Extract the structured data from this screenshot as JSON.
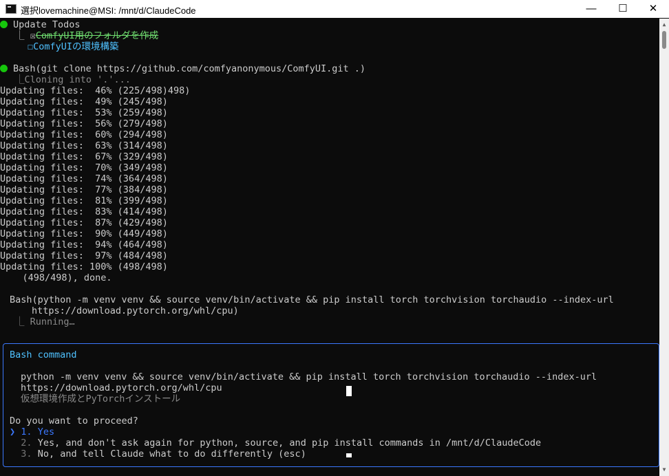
{
  "window": {
    "title": "選択lovemachine@MSI: /mnt/d/ClaudeCode",
    "minimize": "—",
    "maximize": "☐",
    "close": "✕"
  },
  "todos": {
    "header": "Update Todos",
    "items": [
      {
        "prefix": "⎿ ☒",
        "label": "ComfyUI用のフォルダを作成",
        "done": true
      },
      {
        "prefix": "☐",
        "label": "ComfyUIの環境構築",
        "done": false
      }
    ]
  },
  "clone": {
    "command": "Bash(git clone https://github.com/comfyanonymous/ComfyUI.git .)",
    "status": "⎿Cloning into '.'...",
    "progress": [
      "Updating files:  46% (225/498)498)",
      "Updating files:  49% (245/498)",
      "Updating files:  53% (259/498)",
      "Updating files:  56% (279/498)",
      "Updating files:  60% (294/498)",
      "Updating files:  63% (314/498)",
      "Updating files:  67% (329/498)",
      "Updating files:  70% (349/498)",
      "Updating files:  74% (364/498)",
      "Updating files:  77% (384/498)",
      "Updating files:  81% (399/498)",
      "Updating files:  83% (414/498)",
      "Updating files:  87% (429/498)",
      "Updating files:  90% (449/498)",
      "Updating files:  94% (464/498)",
      "Updating files:  97% (484/498)",
      "Updating files: 100% (498/498)"
    ],
    "done": "    (498/498), done."
  },
  "pip": {
    "command_line1": "Bash(python -m venv venv && source venv/bin/activate && pip install torch torchvision torchaudio --index-url",
    "command_line2": "https://download.pytorch.org/whl/cpu)",
    "status": "⎿ Running…"
  },
  "prompt": {
    "title": "Bash command",
    "command_line1": "python -m venv venv && source venv/bin/activate && pip install torch torchvision torchaudio --index-url",
    "command_line2": "https://download.pytorch.org/whl/cpu",
    "description": "仮想環境作成とPyTorchインストール",
    "question": "Do you want to proceed?",
    "options": [
      {
        "marker": "❯",
        "num": "1.",
        "label": "Yes"
      },
      {
        "marker": " ",
        "num": "2.",
        "label": "Yes, and don't ask again for python, source, and pip install commands in /mnt/d/ClaudeCode"
      },
      {
        "marker": " ",
        "num": "3.",
        "label": "No, and tell Claude what to do differently (esc)"
      }
    ]
  },
  "colors": {
    "accent": "#3b78ff",
    "success": "#16c60c",
    "background": "#0c0c0c"
  }
}
